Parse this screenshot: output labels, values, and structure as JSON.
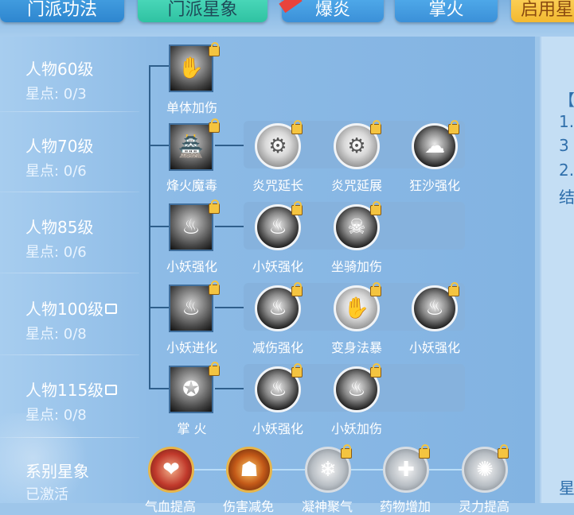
{
  "tabs": [
    "门派功法",
    "门派星象",
    "爆炎",
    "掌火",
    "启用星"
  ],
  "rows": [
    {
      "level": "人物60级",
      "points": "星点: 0/3",
      "locked": false
    },
    {
      "level": "人物70级",
      "points": "星点: 0/6",
      "locked": false
    },
    {
      "level": "人物85级",
      "points": "星点: 0/6",
      "locked": false
    },
    {
      "level": "人物100级",
      "points": "星点: 0/8",
      "locked": true
    },
    {
      "level": "人物115级",
      "points": "星点: 0/8",
      "locked": true
    }
  ],
  "skills": {
    "r1": [
      "单体加伤"
    ],
    "r2": [
      "烽火魔毒",
      "炎咒延长",
      "炎咒延展",
      "狂沙强化"
    ],
    "r3": [
      "小妖强化",
      "小妖强化",
      "坐骑加伤"
    ],
    "r4": [
      "小妖进化",
      "减伤强化",
      "变身法暴",
      "小妖强化"
    ],
    "r5": [
      "掌 火",
      "小妖强化",
      "小妖加伤"
    ]
  },
  "series": {
    "label": "系别星象",
    "status": "已激活",
    "items": [
      "气血提高",
      "伤害减免",
      "凝神聚气",
      "药物增加",
      "灵力提高"
    ]
  },
  "right_panel": [
    "【",
    "1.",
    "3",
    "2.",
    "结",
    "星"
  ],
  "colors": {
    "panel": "#86b2dd",
    "lock": "#f4c440",
    "tab_active": "#2fc2a2"
  }
}
